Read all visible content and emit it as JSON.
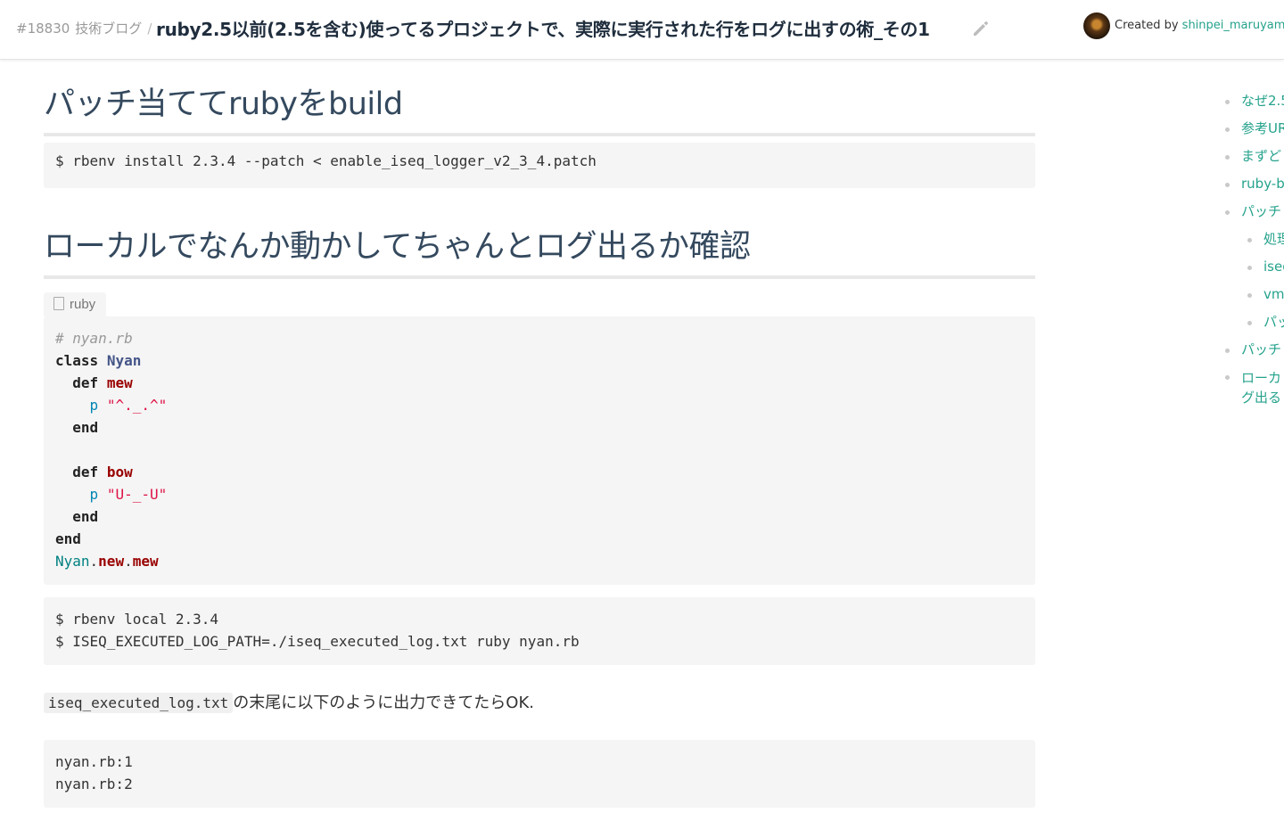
{
  "header": {
    "post_number": "#18830",
    "category": "技術ブログ",
    "separator": "/",
    "title": "ruby2.5以前(2.5を含む)使ってるプロジェクトで、実際に実行された行をログに出すの術_その1",
    "created_by_label": "Created by",
    "author": "shinpei_maruyama"
  },
  "sections": [
    {
      "heading": "パッチ当ててrubyをbuild"
    },
    {
      "heading": "ローカルでなんか動かしてちゃんとログ出るか確認"
    }
  ],
  "code_blocks": {
    "install": "$ rbenv install 2.3.4 --patch < enable_iseq_logger_v2_3_4.patch",
    "ruby_lang": "ruby",
    "run": "$ rbenv local 2.3.4\n$ ISEQ_EXECUTED_LOG_PATH=./iseq_executed_log.txt ruby nyan.rb",
    "output": "nyan.rb:1\nnyan.rb:2"
  },
  "ruby_code": {
    "comment": "# nyan.rb",
    "kw_class": "class",
    "class_name": "Nyan",
    "kw_def": "def",
    "method_mew": "mew",
    "p": "p",
    "str_mew": "\"^._.^\"",
    "kw_end": "end",
    "method_bow": "bow",
    "str_bow": "\"U-_-U\"",
    "call_const": "Nyan",
    "call_new": "new",
    "call_mew": "mew",
    "dot": "."
  },
  "paragraph": {
    "code": "iseq_executed_log.txt",
    "text": "の末尾に以下のように出力できてたらOK."
  },
  "toc": {
    "items": [
      {
        "label": "なぜ2.5"
      },
      {
        "label": "参考URL"
      },
      {
        "label": "まずど"
      },
      {
        "label": "ruby-bu"
      },
      {
        "label": "パッチ"
      },
      {
        "label": "処理",
        "sub": true
      },
      {
        "label": "iseq",
        "sub": true
      },
      {
        "label": "vm_",
        "sub": true
      },
      {
        "label": "パッ",
        "sub": true
      },
      {
        "label": "パッチ"
      },
      {
        "label": "ローカグ出る"
      }
    ]
  },
  "colors": {
    "link": "#25a28c",
    "heading": "#34495e",
    "code_bg": "#f5f5f5"
  }
}
